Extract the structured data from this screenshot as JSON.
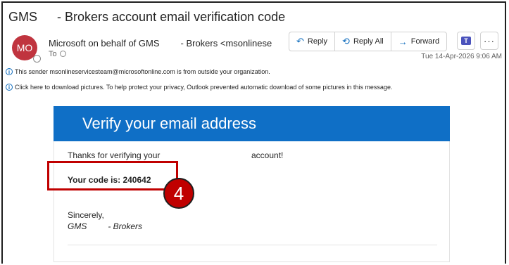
{
  "email": {
    "subject_org": "GMS",
    "subject_rest": "- Brokers account email verification code",
    "avatar_initials": "MO",
    "sender_name": "Microsoft on behalf of GMS",
    "sender_addr": "- Brokers <msonlinese",
    "to_label": "To",
    "date": "Tue 14-Apr-2026 9:06 AM",
    "info_external": "This sender msonlineservicesteam@microsoftonline.com is from outside your organization.",
    "info_pictures": "Click here to download pictures. To help protect your privacy, Outlook prevented automatic download of some pictures in this message."
  },
  "actions": {
    "reply": "Reply",
    "reply_all": "Reply All",
    "forward": "Forward",
    "more": "···"
  },
  "body": {
    "heading": "Verify your email address",
    "thanks": "Thanks for verifying your",
    "thanks_end": "account!",
    "code_text": "Your code is: 240642",
    "sincerely": "Sincerely,",
    "sig_org": "GMS",
    "sig_rest": "- Brokers"
  },
  "annotation": {
    "step_number": "4",
    "highlight_color": "#c00000"
  },
  "colors": {
    "banner": "#0f6fc6",
    "avatar": "#c0343f",
    "accent": "#0f6cbd"
  }
}
